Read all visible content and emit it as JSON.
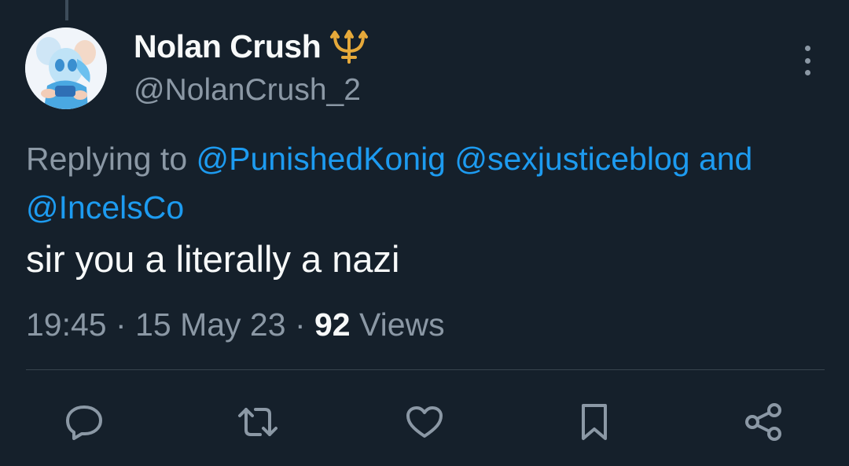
{
  "author": {
    "display_name": "Nolan Crush",
    "handle": "@NolanCrush_2",
    "badge_icon": "trident-icon"
  },
  "reply": {
    "prefix": "Replying to",
    "mention_1": "@PunishedKonig",
    "mention_2": "@sexjusticeblog",
    "connector": "and",
    "mention_3": "@IncelsCo"
  },
  "tweet": {
    "text": "sir you a literally a nazi",
    "time": "19:45",
    "date": "15 May 23",
    "views_count": "92",
    "views_label": "Views"
  },
  "actions": [
    "reply-icon",
    "retweet-icon",
    "like-icon",
    "bookmark-icon",
    "share-icon"
  ],
  "colors": {
    "background": "#15202b",
    "text": "#f7f9f9",
    "secondary_text": "#8b98a5",
    "link": "#1d9bf0",
    "divider": "#38444d",
    "badge": "#e6a93a"
  }
}
